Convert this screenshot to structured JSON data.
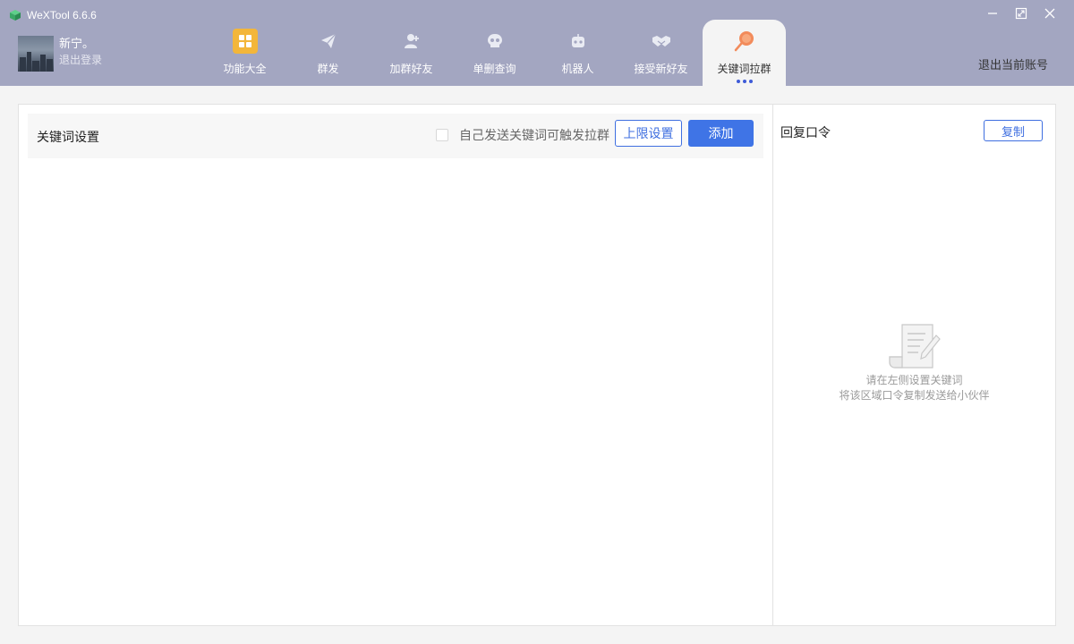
{
  "app": {
    "title": "WeXTool 6.6.6"
  },
  "user": {
    "name": "新宁。",
    "logout_label": "退出登录"
  },
  "nav": {
    "items": [
      {
        "label": "功能大全",
        "icon": "grid-apps-icon"
      },
      {
        "label": "群发",
        "icon": "paper-plane-icon"
      },
      {
        "label": "加群好友",
        "icon": "add-user-icon"
      },
      {
        "label": "单删查询",
        "icon": "skull-icon"
      },
      {
        "label": "机器人",
        "icon": "robot-icon"
      },
      {
        "label": "接受新好友",
        "icon": "handshake-icon"
      },
      {
        "label": "关键词拉群",
        "icon": "lollipop-icon",
        "active": true
      }
    ]
  },
  "header": {
    "logout_account_label": "退出当前账号"
  },
  "keywords": {
    "title": "关键词设置",
    "checkbox_label": "自己发送关键词可触发拉群",
    "limit_button": "上限设置",
    "add_button": "添加"
  },
  "reply": {
    "title": "回复口令",
    "copy_button": "复制",
    "empty_line1": "请在左侧设置关键词",
    "empty_line2": "将该区域口令复制发送给小伙伴"
  },
  "colors": {
    "header_bg": "#a3a6c1",
    "accent": "#3f74e6",
    "grid_icon_bg": "#f3b63a",
    "lollipop": "#f28b5b"
  }
}
